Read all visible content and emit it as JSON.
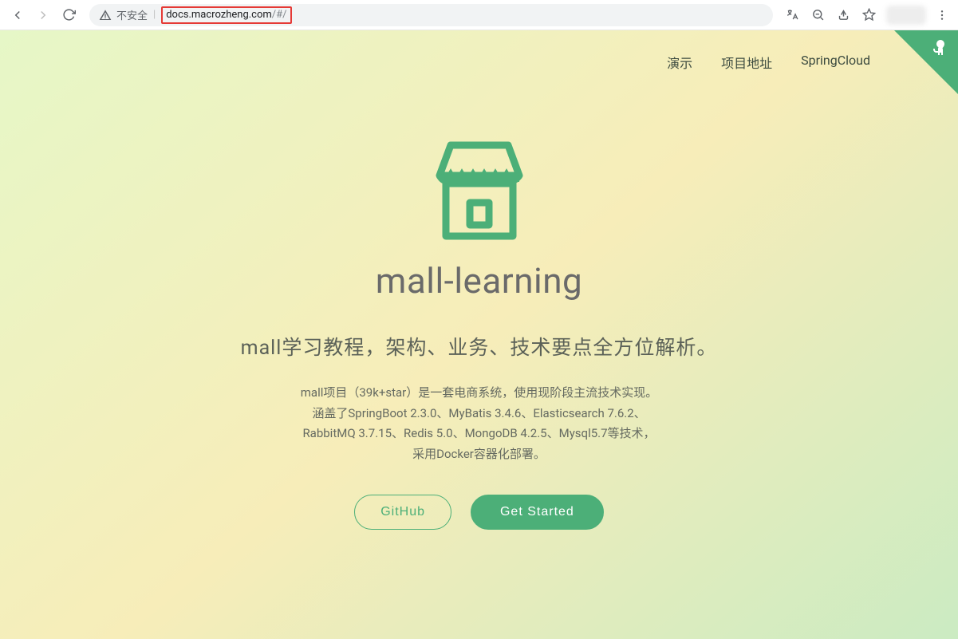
{
  "browser": {
    "insecure_label": "不安全",
    "url_host": "docs.macrozheng.com",
    "url_path": "/#/"
  },
  "nav": {
    "items": [
      {
        "label": "演示"
      },
      {
        "label": "项目地址"
      },
      {
        "label": "SpringCloud"
      }
    ]
  },
  "hero": {
    "title": "mall-learning",
    "subtitle": "mall学习教程，架构、业务、技术要点全方位解析。",
    "desc_lines": [
      "mall项目（39k+star）是一套电商系统，使用现阶段主流技术实现。",
      "涵盖了SpringBoot 2.3.0、MyBatis 3.4.6、Elasticsearch 7.6.2、",
      "RabbitMQ 3.7.15、Redis 5.0、MongoDB 4.2.5、Mysql5.7等技术，",
      "采用Docker容器化部署。"
    ],
    "buttons": {
      "github": "GitHub",
      "get_started": "Get Started"
    }
  }
}
